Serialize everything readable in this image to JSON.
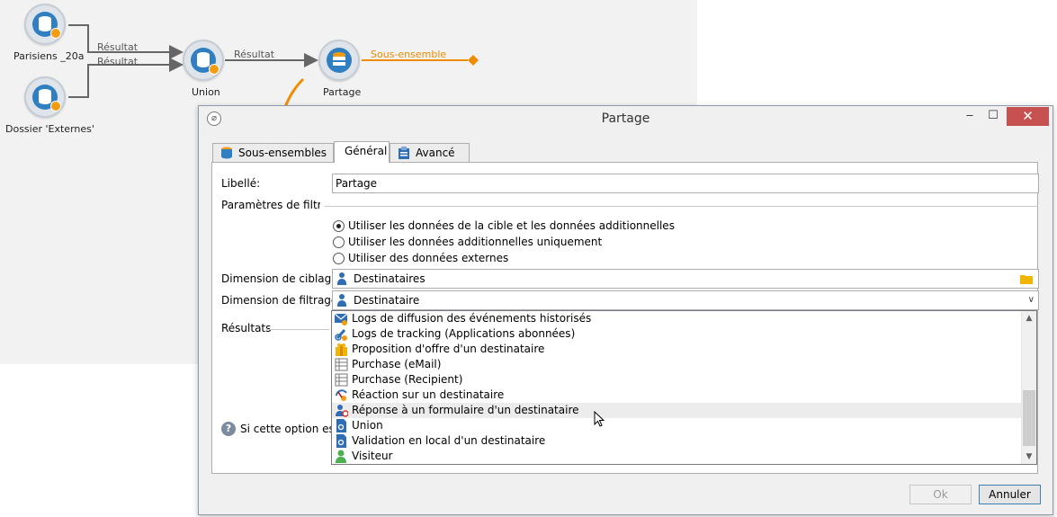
{
  "workflow": {
    "nodes": [
      {
        "label": "Parisiens _20a"
      },
      {
        "label": "Dossier 'Externes'"
      },
      {
        "label": "Union"
      },
      {
        "label": "Partage"
      }
    ],
    "wires": {
      "result_1": "Résultat",
      "result_2": "Résultat",
      "result_3": "Résultat",
      "subset": "Sous-ensemble"
    },
    "colors": {
      "accent": "#f08c00",
      "node_core": "#2f7fc1"
    }
  },
  "dialog": {
    "title": "Partage",
    "tabs": [
      {
        "label": "Sous-ensembles",
        "icon": "database-icon"
      },
      {
        "label": "Général",
        "active": true
      },
      {
        "label": "Avancé",
        "icon": "clipboard-icon"
      }
    ],
    "libelle": {
      "label": "Libellé:",
      "value": "Partage"
    },
    "filter_params": {
      "label": "Paramètres de filtrage",
      "options": [
        {
          "label": "Utiliser les données de la cible et les données additionnelles",
          "checked": true
        },
        {
          "label": "Utiliser les données additionnelles uniquement",
          "checked": false
        },
        {
          "label": "Utiliser des données externes",
          "checked": false
        }
      ]
    },
    "targeting_dimension": {
      "label": "Dimension de ciblage:",
      "value": "Destinataires"
    },
    "filtering_dimension": {
      "label": "Dimension de filtrage:",
      "value": "Destinataire"
    },
    "results": {
      "label": "Résultats"
    },
    "help_text": "Si cette option est c",
    "dropdown_items": [
      {
        "label": "Logs de diffusion des événements historisés",
        "icon": "mail-log-icon"
      },
      {
        "label": "Logs de tracking (Applications abonnées)",
        "icon": "tracking-icon"
      },
      {
        "label": "Proposition d'offre d'un destinataire",
        "icon": "gift-icon"
      },
      {
        "label": "Purchase (eMail)",
        "icon": "table-icon"
      },
      {
        "label": "Purchase (Recipient)",
        "icon": "table-icon"
      },
      {
        "label": "Réaction sur un destinataire",
        "icon": "reaction-icon"
      },
      {
        "label": "Réponse à un formulaire d'un destinataire",
        "icon": "form-response-icon",
        "hover": true
      },
      {
        "label": "Union",
        "icon": "document-icon"
      },
      {
        "label": "Validation en local d'un destinataire",
        "icon": "document-icon"
      },
      {
        "label": "Visiteur",
        "icon": "visitor-icon"
      }
    ],
    "buttons": {
      "ok": "Ok",
      "cancel": "Annuler"
    }
  }
}
